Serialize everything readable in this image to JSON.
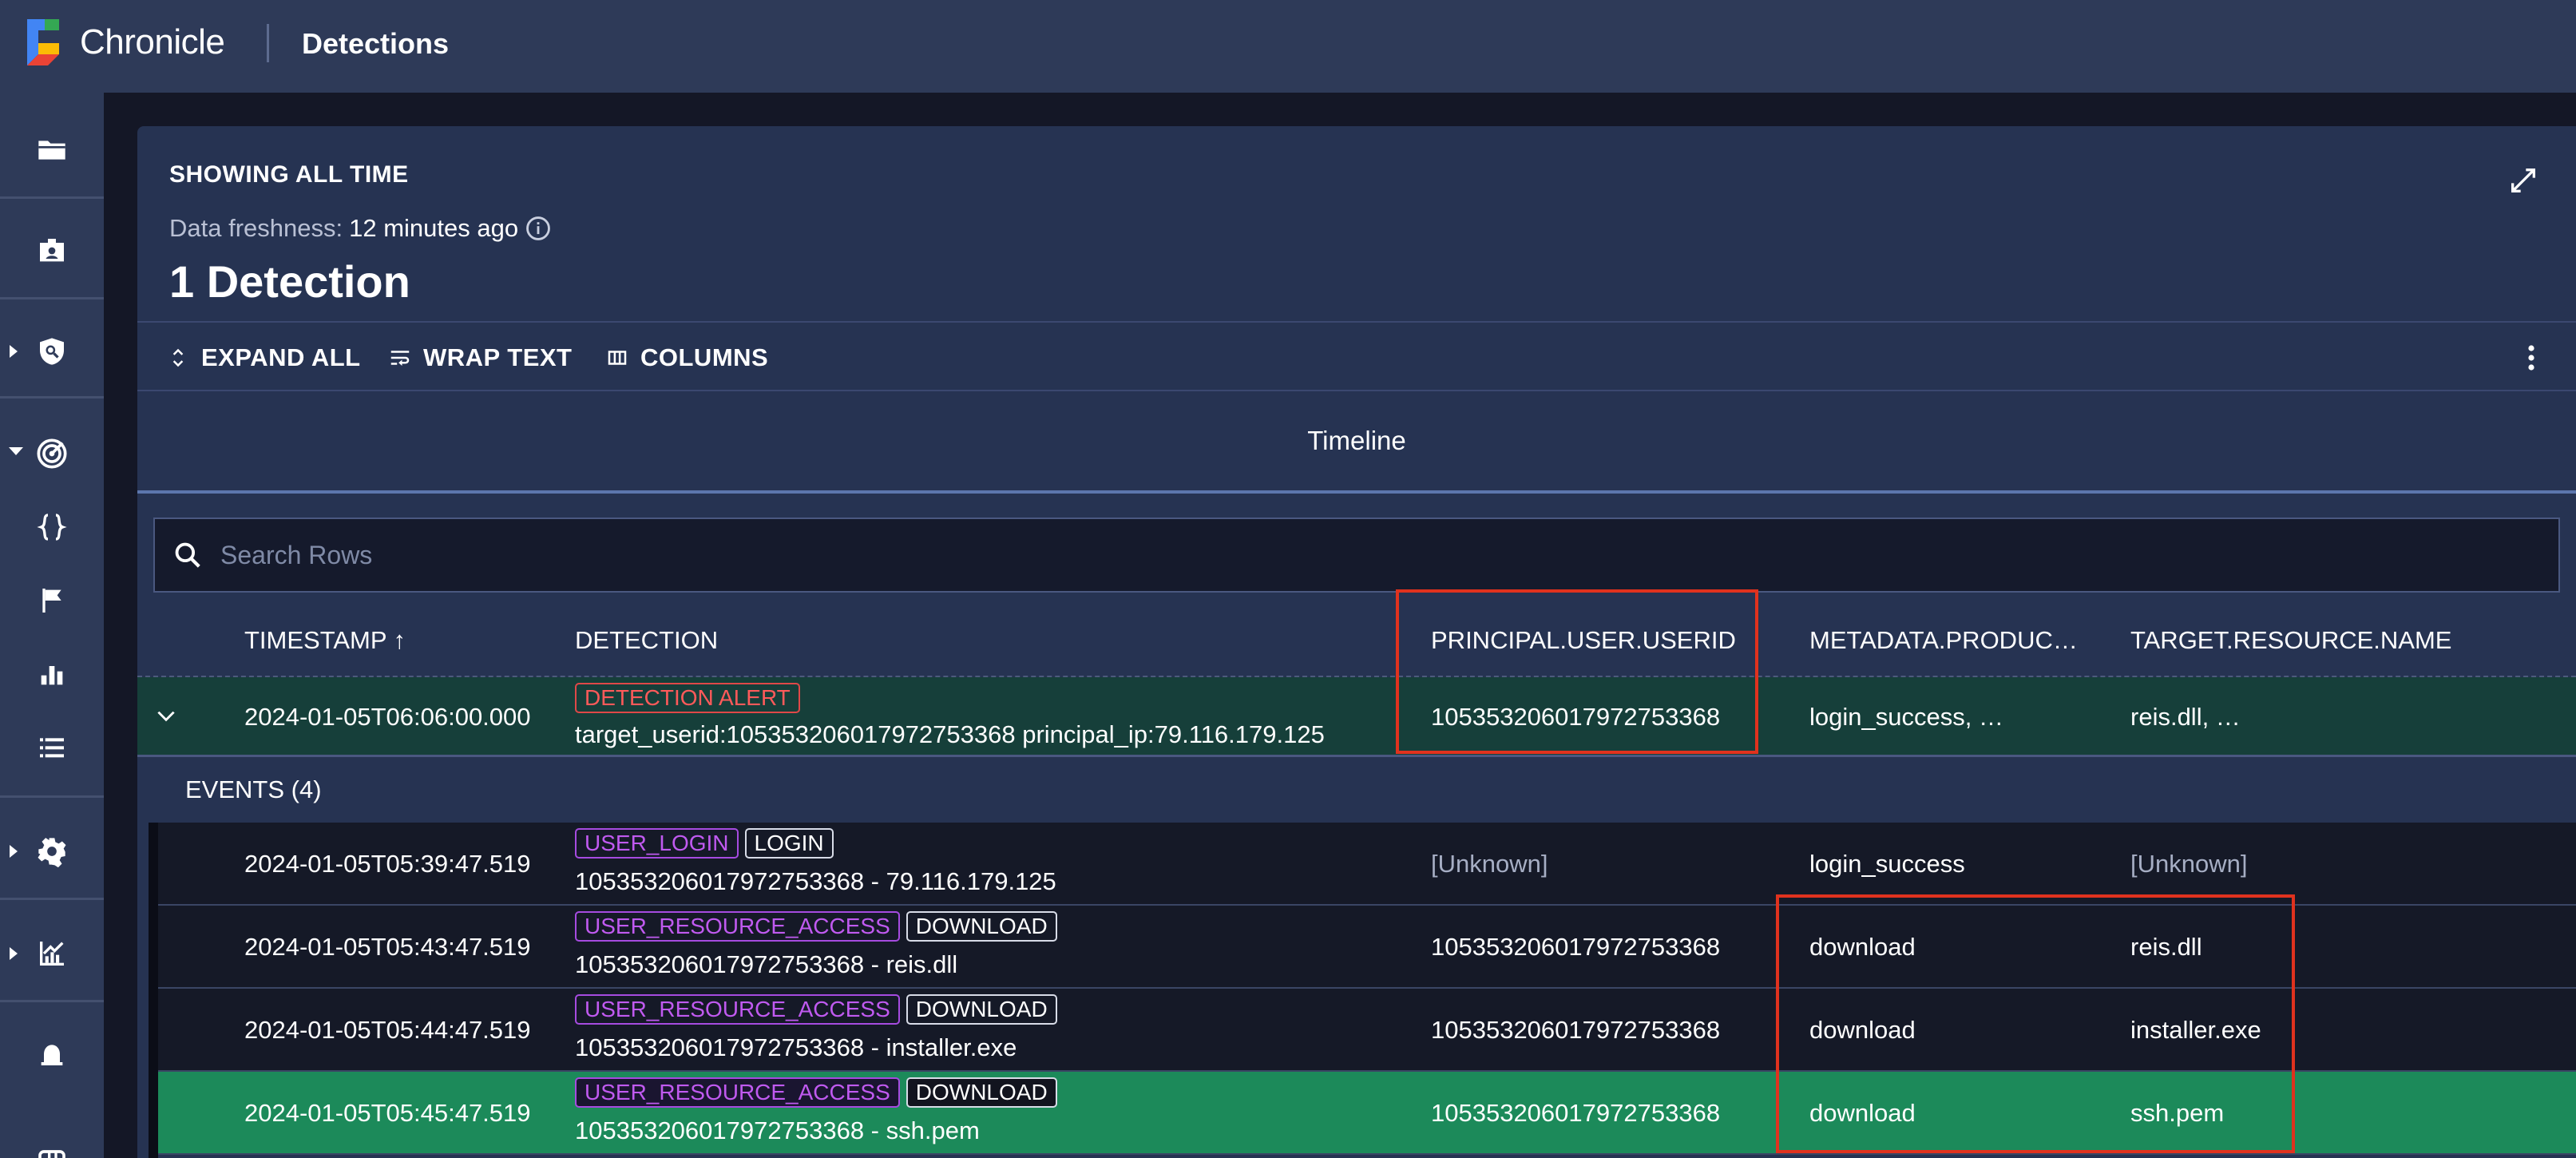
{
  "app": {
    "brand": "Chronicle",
    "section": "Detections"
  },
  "panel": {
    "showing": "SHOWING ALL TIME",
    "freshness_label": "Data freshness:",
    "freshness_value": "12 minutes ago",
    "count": "1 Detection"
  },
  "toolbar": {
    "expand_all": "EXPAND ALL",
    "wrap_text": "WRAP TEXT",
    "columns": "COLUMNS"
  },
  "tabs": {
    "timeline": "Timeline"
  },
  "search": {
    "placeholder": "Search Rows"
  },
  "columns": {
    "timestamp": "TIMESTAMP ↑",
    "detection": "DETECTION",
    "userid": "PRINCIPAL.USER.USERID",
    "product": "METADATA.PRODUC…",
    "target": "TARGET.RESOURCE.NAME"
  },
  "detection_row": {
    "timestamp": "2024-01-05T06:06:00.000",
    "badge": "DETECTION ALERT",
    "text": "target_userid:105353206017972753368 principal_ip:79.116.179.125",
    "userid": "105353206017972753368",
    "product": "login_success, …",
    "target": "reis.dll, …"
  },
  "events_label": "EVENTS (4)",
  "events": [
    {
      "timestamp": "2024-01-05T05:39:47.519",
      "type": "USER_LOGIN",
      "action": "LOGIN",
      "text": "105353206017972753368 - 79.116.179.125",
      "userid": "[Unknown]",
      "product": "login_success",
      "target": "[Unknown]"
    },
    {
      "timestamp": "2024-01-05T05:43:47.519",
      "type": "USER_RESOURCE_ACCESS",
      "action": "DOWNLOAD",
      "text": "105353206017972753368 - reis.dll",
      "userid": "105353206017972753368",
      "product": "download",
      "target": "reis.dll"
    },
    {
      "timestamp": "2024-01-05T05:44:47.519",
      "type": "USER_RESOURCE_ACCESS",
      "action": "DOWNLOAD",
      "text": "105353206017972753368 - installer.exe",
      "userid": "105353206017972753368",
      "product": "download",
      "target": "installer.exe"
    },
    {
      "timestamp": "2024-01-05T05:45:47.519",
      "type": "USER_RESOURCE_ACCESS",
      "action": "DOWNLOAD",
      "text": "105353206017972753368 - ssh.pem",
      "userid": "105353206017972753368",
      "product": "download",
      "target": "ssh.pem"
    }
  ],
  "colors": {
    "topbar": "#2e3a58",
    "panel": "#263352",
    "detection_row": "#163f3a",
    "selected_row": "#1c8a5a",
    "highlight": "#e0321e"
  },
  "icons": [
    "chronicle-logo-icon",
    "folder-icon",
    "case-icon",
    "shield-search-icon",
    "radar-icon",
    "braces-icon",
    "flag-icon",
    "bar-chart-icon",
    "list-icon",
    "gear-icon",
    "trend-chart-icon",
    "alarm-icon",
    "fullscreen-icon",
    "info-icon",
    "expand-all-icon",
    "wrap-text-icon",
    "columns-icon",
    "kebab-icon",
    "search-icon",
    "chevron-down-icon"
  ]
}
